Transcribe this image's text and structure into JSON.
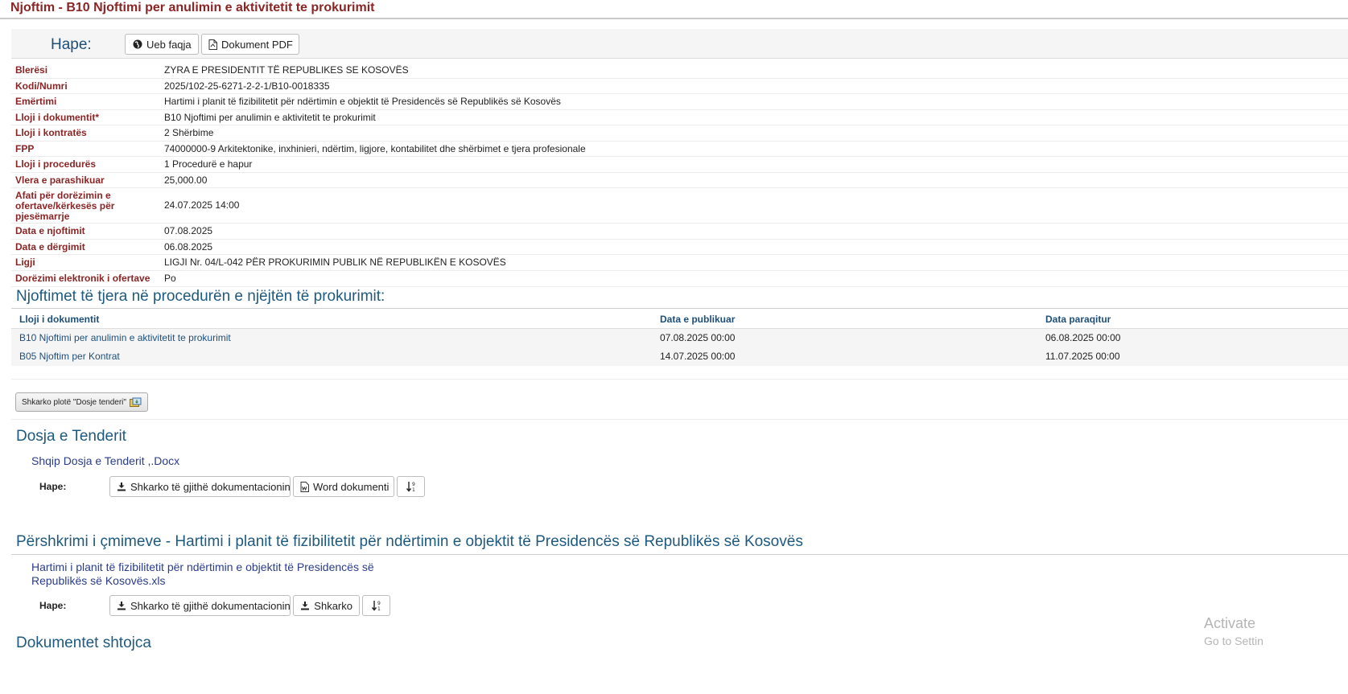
{
  "page": {
    "title": "Njoftim - B10 Njoftimi per anulimin e aktivitetit te prokurimit"
  },
  "open_bar": {
    "label": "Hape:",
    "web_button": "Ueb faqja",
    "pdf_button": "Dokument PDF"
  },
  "details": [
    {
      "label": "Blerësi",
      "value": "ZYRA E PRESIDENTIT TË REPUBLIKES SE KOSOVËS"
    },
    {
      "label": "Kodi/Numri",
      "value": "2025/102-25-6271-2-2-1/B10-0018335"
    },
    {
      "label": "Emërtimi",
      "value": "Hartimi i planit të fizibilitetit për ndërtimin e objektit të Presidencës së Republikës së Kosovës"
    },
    {
      "label": "Lloji i dokumentit*",
      "value": "B10 Njoftimi per anulimin e aktivitetit te prokurimit"
    },
    {
      "label": "Lloji i kontratës",
      "value": "2 Shërbime"
    },
    {
      "label": "FPP",
      "value": "74000000-9 Arkitektonike, inxhinieri, ndërtim, ligjore, kontabilitet dhe shërbimet e tjera profesionale"
    },
    {
      "label": "Lloji i procedurës",
      "value": "1 Procedurë e hapur"
    },
    {
      "label": "Vlera e parashikuar",
      "value": "25,000.00"
    },
    {
      "label": "Afati për dorëzimin e ofertave/kërkesës për pjesëmarrje",
      "value": "24.07.2025 14:00"
    },
    {
      "label": "Data e njoftimit",
      "value": "07.08.2025"
    },
    {
      "label": "Data e dërgimit",
      "value": "06.08.2025"
    },
    {
      "label": "Ligji",
      "value": "LIGJI Nr. 04/L-042 PËR PROKURIMIN PUBLIK NË REPUBLIKËN E KOSOVËS"
    },
    {
      "label": "Dorëzimi elektronik i ofertave",
      "value": "Po"
    }
  ],
  "other_notices": {
    "heading": "Njoftimet të tjera në procedurën e njëjtën të prokurimit:",
    "headers": [
      "Lloji i dokumentit",
      "Data e publikuar",
      "Data paraqitur"
    ],
    "rows": [
      [
        "B10 Njoftimi per anulimin e aktivitetit te prokurimit",
        "07.08.2025 00:00",
        "06.08.2025 00:00"
      ],
      [
        "B05 Njoftim per Kontrat",
        "14.07.2025 00:00",
        "11.07.2025 00:00"
      ]
    ]
  },
  "download_full": {
    "label": "Shkarko plotë \"Dosje tenderi\""
  },
  "tender_file": {
    "heading": "Dosja e Tenderit",
    "file": "Shqip Dosja e Tenderit ,.Docx",
    "open_label": "Hape:",
    "download_all": "Shkarko të gjithë dokumentacionin",
    "word_button": "Word dokumenti"
  },
  "price_description": {
    "heading": "Përshkrimi i çmimeve - Hartimi i planit të fizibilitetit për ndërtimin e objektit të Presidencës së Republikës së Kosovës",
    "file_line1": "Hartimi i planit të fizibilitetit për ndërtimin e objektit të Presidencës së",
    "file_line2": "Republikës së Kosovës.xls",
    "open_label": "Hape:",
    "download_all": "Shkarko të gjithë dokumentacionin",
    "download": "Shkarko"
  },
  "attachments": {
    "heading": "Dokumentet shtojca"
  },
  "watermark": {
    "line1": "Activate",
    "line2": "Go to Settin"
  },
  "colors": {
    "label_red": "#8b2525",
    "heading_blue": "#1e5a80",
    "link_blue": "#1e4f7a"
  }
}
